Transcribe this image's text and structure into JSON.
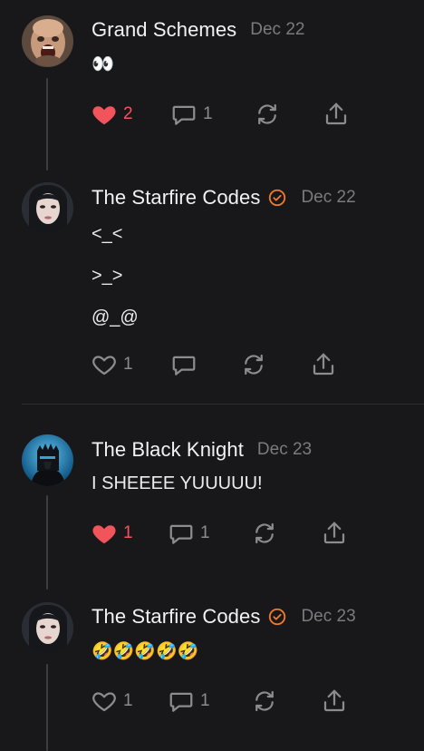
{
  "posts": [
    {
      "author": "Grand Schemes",
      "verified": false,
      "date": "Dec 22",
      "lines": [
        "👀"
      ],
      "likes": "2",
      "liked": true,
      "replies": "1"
    },
    {
      "author": "The Starfire Codes",
      "verified": true,
      "date": "Dec 22",
      "lines": [
        "<_<",
        ">_>",
        "@_@"
      ],
      "likes": "1",
      "liked": false,
      "replies": ""
    },
    {
      "author": "The Black Knight",
      "verified": false,
      "date": "Dec 23",
      "lines": [
        "I SHEEEE YUUUUU!"
      ],
      "likes": "1",
      "liked": true,
      "replies": "1"
    },
    {
      "author": "The Starfire Codes",
      "verified": true,
      "date": "Dec 23",
      "lines": [
        "🤣🤣🤣🤣🤣"
      ],
      "likes": "1",
      "liked": false,
      "replies": "1"
    }
  ],
  "colors": {
    "background": "#18181a",
    "liked": "#f2545b",
    "muted": "#8b8b90",
    "verified": "#f07a2b",
    "thread_line": "#3e3e42"
  },
  "icons": [
    "heart-icon",
    "comment-icon",
    "restack-icon",
    "share-icon",
    "verified-icon"
  ]
}
